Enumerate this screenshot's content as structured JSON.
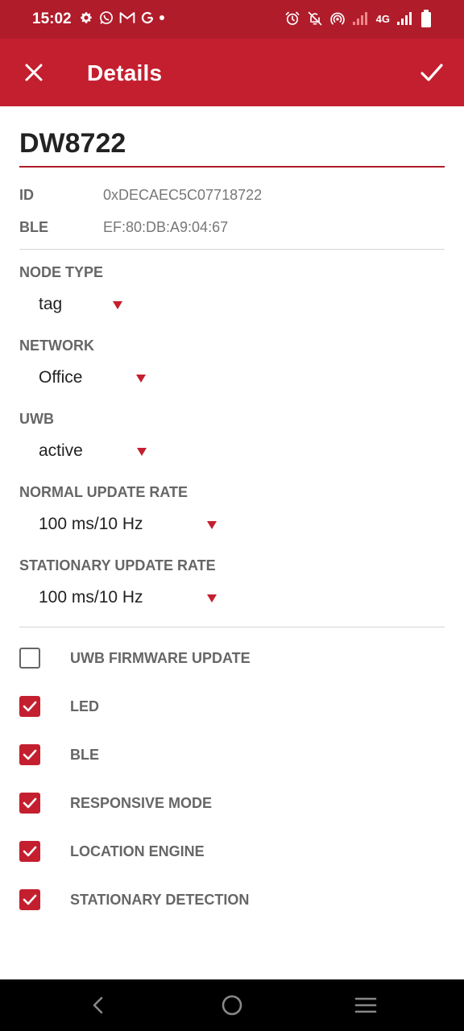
{
  "status_bar": {
    "time": "15:02",
    "network_label": "4G",
    "left_icons": [
      "gear-icon",
      "whatsapp-icon",
      "gmail-icon",
      "google-icon",
      "dot-icon"
    ],
    "right_icons": [
      "alarm-icon",
      "bell-off-icon",
      "hotspot-icon",
      "signal-icon",
      "battery-icon"
    ]
  },
  "app_bar": {
    "title": "Details",
    "close_icon": "close-icon",
    "confirm_icon": "check-icon",
    "color": "#c41f2f"
  },
  "device": {
    "name": "DW8722",
    "id_label": "ID",
    "id_value": "0xDECAEC5C07718722",
    "ble_label": "BLE",
    "ble_value": "EF:80:DB:A9:04:67"
  },
  "settings": {
    "node_type": {
      "label": "NODE TYPE",
      "value": "tag"
    },
    "network": {
      "label": "NETWORK",
      "value": "Office"
    },
    "uwb": {
      "label": "UWB",
      "value": "active"
    },
    "normal_update_rate": {
      "label": "NORMAL UPDATE RATE",
      "value": "100 ms/10 Hz"
    },
    "stationary_update_rate": {
      "label": "STATIONARY UPDATE RATE",
      "value": "100 ms/10 Hz"
    }
  },
  "options": [
    {
      "label": "UWB FIRMWARE UPDATE",
      "checked": false
    },
    {
      "label": "LED",
      "checked": true
    },
    {
      "label": "BLE",
      "checked": true
    },
    {
      "label": "RESPONSIVE MODE",
      "checked": true
    },
    {
      "label": "LOCATION ENGINE",
      "checked": true
    },
    {
      "label": "STATIONARY DETECTION",
      "checked": true
    }
  ],
  "nav_bar": {
    "buttons": [
      "back-icon",
      "home-icon",
      "menu-icon"
    ]
  }
}
